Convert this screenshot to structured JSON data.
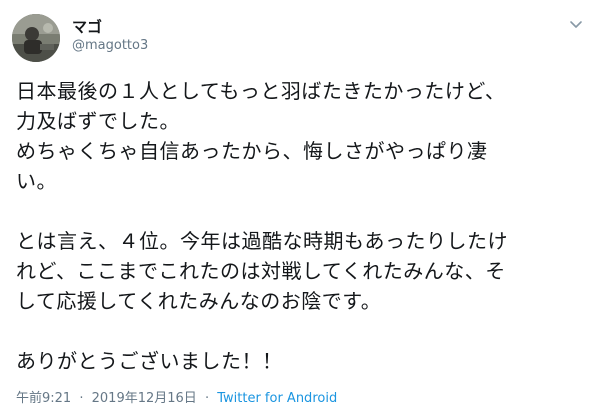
{
  "user": {
    "display_name": "マゴ",
    "handle": "@magotto3"
  },
  "tweet": {
    "lines": [
      "日本最後の１人としてもっと羽ばたきたかったけど、",
      "力及ばずでした。",
      "めちゃくちゃ自信あったから、悔しさがやっぱり凄",
      "い。",
      "",
      "とは言え、４位。今年は過酷な時期もあったりしたけ",
      "れど、ここまでこれたのは対戦してくれたみんな、そ",
      "して応援してくれたみんなのお陰です。",
      "",
      "ありがとうございました！！"
    ]
  },
  "meta": {
    "time": "午前9:21",
    "separator": "·",
    "date": "2019年12月16日",
    "client": "Twitter for Android"
  },
  "icons": {
    "avatar": "profile-photo",
    "caret": "chevron-down-icon"
  },
  "colors": {
    "text": "#14171a",
    "secondary": "#657786",
    "link": "#1b95e0"
  }
}
